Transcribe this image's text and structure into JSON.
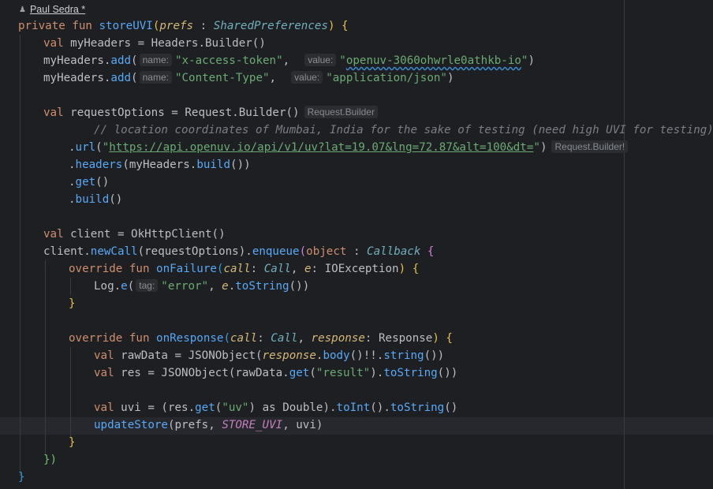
{
  "author": {
    "icon": "user-icon",
    "name": "Paul Sedra *"
  },
  "lines": {
    "l1": {
      "kw1": "private fun ",
      "fn": "storeUVI",
      "open": "(",
      "param": "prefs",
      "colon": " : ",
      "type": "SharedPreferences",
      "close": ") {"
    },
    "l2": {
      "kw": "val ",
      "rest": "myHeaders = Headers.Builder()"
    },
    "l3": {
      "pre": "myHeaders.",
      "call": "add",
      "open": "(",
      "hint1": "name:",
      "s1": "\"x-access-token\"",
      "mid": ",  ",
      "hint2": "value:",
      "s2a": "\"",
      "s2b": "openuv-3060ohwrle0athkb-io",
      "s2c": "\"",
      "close": ")"
    },
    "l4": {
      "pre": "myHeaders.",
      "call": "add",
      "open": "(",
      "hint1": "name:",
      "s1": "\"Content-Type\"",
      "mid": ",  ",
      "hint2": "value:",
      "s2": "\"application/json\"",
      "close": ")"
    },
    "l6": {
      "kw": "val ",
      "rest": "requestOptions = Request.Builder()",
      "inlay": "Request.Builder"
    },
    "l7": {
      "comment": "// location coordinates of Mumbai, India for the sake of testing (need high UVI for testing)"
    },
    "l8": {
      "dot": ".",
      "call": "url",
      "open": "(",
      "q1": "\"",
      "url": "https://api.openuv.io/api/v1/uv?lat=19.07&lng=72.87&alt=100&dt=",
      "q2": "\"",
      "close": ")",
      "inlay": "Request.Builder!"
    },
    "l9": {
      "dot": ".",
      "call": "headers",
      "rest": "(myHeaders.",
      "call2": "build",
      "end": "())"
    },
    "l10": {
      "dot": ".",
      "call": "get",
      "end": "()"
    },
    "l11": {
      "dot": ".",
      "call": "build",
      "end": "()"
    },
    "l13": {
      "kw": "val ",
      "rest": "client = OkHttpClient()"
    },
    "l14": {
      "pre": "client.",
      "call": "newCall",
      "mid": "(requestOptions).",
      "call2": "enqueue",
      "open": "(",
      "kw": "object",
      "colon": " : ",
      "type": "Callback",
      "brace": " {"
    },
    "l15": {
      "kw": "override fun ",
      "fn": "onFailure",
      "open": "(",
      "p1": "call",
      "c1": ": ",
      "t1": "Call",
      "sep": ", ",
      "p2": "e",
      "c2": ": ",
      "t2": "IOException",
      "close": ") {"
    },
    "l16": {
      "pre": "Log.",
      "call": "e",
      "open": "(",
      "hint": "tag:",
      "s": "\"error\"",
      "sep": ", ",
      "p": "e",
      "dot": ".",
      "call2": "toString",
      "end": "())"
    },
    "l17": {
      "brace": "}"
    },
    "l19": {
      "kw": "override fun ",
      "fn": "onResponse",
      "open": "(",
      "p1": "call",
      "c1": ": ",
      "t1": "Call",
      "sep": ", ",
      "p2": "response",
      "c2": ": ",
      "t2": "Response",
      "close": ") {"
    },
    "l20": {
      "kw": "val ",
      "pre": "rawData = JSONObject(",
      "p": "response",
      "dot": ".",
      "call": "body",
      "mid": "()!!.",
      "call2": "string",
      "end": "())"
    },
    "l21": {
      "kw": "val ",
      "pre": "res = JSONObject(rawData.",
      "call": "get",
      "open": "(",
      "s": "\"result\"",
      "mid": ").",
      "call2": "toString",
      "end": "())"
    },
    "l23": {
      "kw": "val ",
      "pre": "uvi = (res.",
      "call": "get",
      "open": "(",
      "s": "\"uv\"",
      "as": ") as ",
      "ty": "Double",
      "mid": ").",
      "call2": "toInt",
      "mid2": "().",
      "call3": "toString",
      "end": "()"
    },
    "l24": {
      "call": "updateStore",
      "open": "(prefs, ",
      "const": "STORE_UVI",
      "end": ", uvi)"
    },
    "l25": {
      "brace": "}"
    },
    "l26": {
      "brace": "})"
    },
    "l27": {
      "brace": "}"
    }
  }
}
